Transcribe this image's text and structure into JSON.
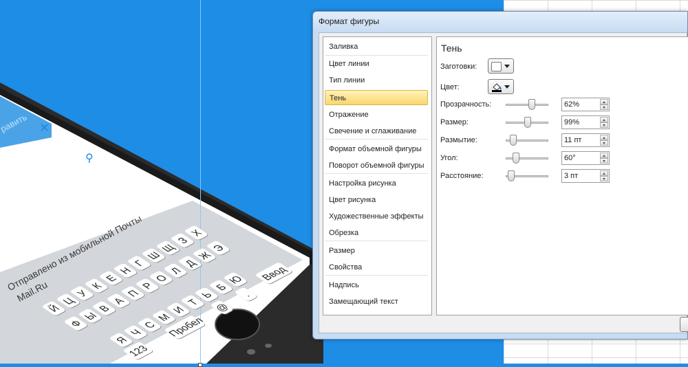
{
  "dialog": {
    "title": "Формат фигуры",
    "categories": [
      {
        "label": "Заливка"
      },
      {
        "label": "Цвет линии"
      },
      {
        "label": "Тип линии"
      },
      {
        "label": "Тень",
        "selected": true
      },
      {
        "label": "Отражение"
      },
      {
        "label": "Свечение и сглаживание"
      },
      {
        "label": "Формат объемной фигуры"
      },
      {
        "label": "Поворот объемной фигуры"
      },
      {
        "label": "Настройка рисунка"
      },
      {
        "label": "Цвет рисунка"
      },
      {
        "label": "Художественные эффекты"
      },
      {
        "label": "Обрезка"
      },
      {
        "label": "Размер"
      },
      {
        "label": "Свойства"
      },
      {
        "label": "Надпись"
      },
      {
        "label": "Замещающий текст"
      }
    ],
    "panel": {
      "title": "Тень",
      "presets_label": "Заготовки:",
      "color_label": "Цвет:",
      "transparency": {
        "label": "Прозрачность:",
        "value": "62%",
        "level": 0.62
      },
      "size": {
        "label": "Размер:",
        "value": "99%",
        "level": 0.5
      },
      "blur": {
        "label": "Размытие:",
        "value": "11 пт",
        "level": 0.1
      },
      "angle": {
        "label": "Угол:",
        "value": "60°",
        "level": 0.17
      },
      "distance": {
        "label": "Расстояние:",
        "value": "3 пт",
        "level": 0.03
      }
    }
  },
  "phone": {
    "header_action": "равить",
    "close_glyph": "✕",
    "attach_glyph": "⚲",
    "signature_line1": "Отправлено из мобильной Почты",
    "signature_line2": "Mail.Ru",
    "keyboard": {
      "row1": [
        "Й",
        "Ц",
        "У",
        "К",
        "Е",
        "Н",
        "Г",
        "Ш",
        "Щ",
        "З",
        "Х"
      ],
      "row2": [
        "Ф",
        "Ы",
        "В",
        "А",
        "П",
        "Р",
        "О",
        "Л",
        "Д",
        "Ж",
        "Э"
      ],
      "row3": [
        "Я",
        "Ч",
        "С",
        "М",
        "И",
        "Т",
        "Ь",
        "Б",
        "Ю"
      ],
      "num_key": "123",
      "space_key": "Пробел",
      "at_key": "@",
      "dot_key": ".",
      "enter_key": "Ввод"
    }
  },
  "colors": {
    "background": "#1e8de6",
    "selected_category": "#f9d66e"
  }
}
